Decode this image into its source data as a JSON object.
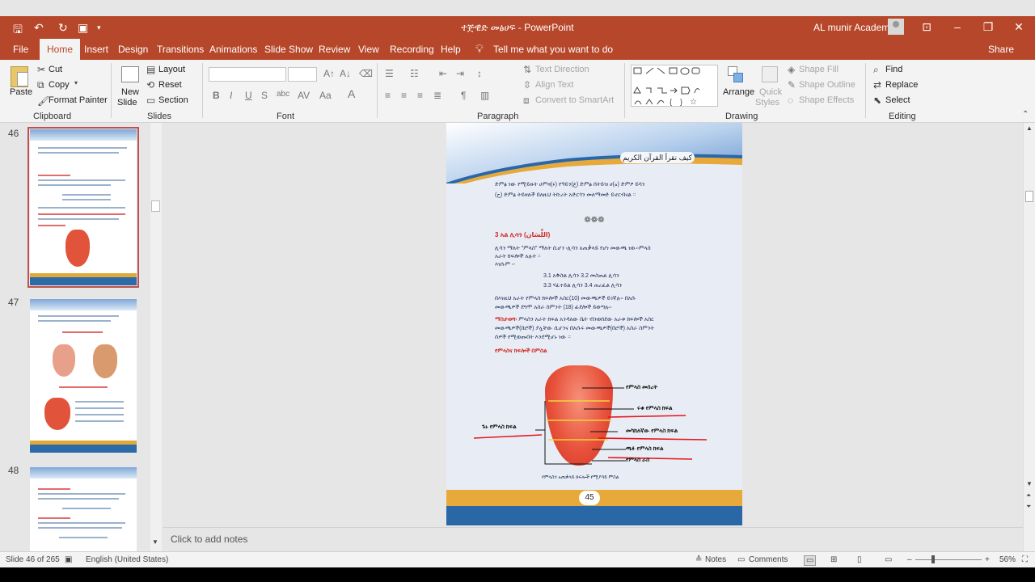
{
  "window": {
    "title": "ተጅዊድ መፅሀፍ  -  PowerPoint",
    "user": "AL munir Academy"
  },
  "tabs": [
    "File",
    "Home",
    "Insert",
    "Design",
    "Transitions",
    "Animations",
    "Slide Show",
    "Review",
    "View",
    "Recording",
    "Help"
  ],
  "tell_me": "Tell me what you want to do",
  "share": "Share",
  "ribbon": {
    "clipboard": {
      "paste": "Paste",
      "cut": "Cut",
      "copy": "Copy",
      "format_painter": "Format Painter",
      "label": "Clipboard"
    },
    "slides": {
      "new_slide_1": "New",
      "new_slide_2": "Slide",
      "layout": "Layout",
      "reset": "Reset",
      "section": "Section",
      "label": "Slides"
    },
    "font": {
      "label": "Font"
    },
    "paragraph": {
      "text_direction": "Text Direction",
      "align_text": "Align Text",
      "convert_smartart": "Convert to SmartArt",
      "label": "Paragraph"
    },
    "drawing": {
      "arrange": "Arrange",
      "quick_styles_1": "Quick",
      "quick_styles_2": "Styles",
      "shape_fill": "Shape Fill",
      "shape_outline": "Shape Outline",
      "shape_effects": "Shape Effects",
      "label": "Drawing"
    },
    "editing": {
      "find": "Find",
      "replace": "Replace",
      "select": "Select",
      "label": "Editing"
    }
  },
  "thumbnails": [
    {
      "number": "46"
    },
    {
      "number": "47"
    },
    {
      "number": "48"
    }
  ],
  "slide": {
    "arabic_title": "كيف نقرأ القرآن الكريم",
    "intro_1": "ድምፅ ነው የሚይዙት ሀምዛ(ء)  የዓይን(ع)  ድምፅ ሰትይዝ ሀ(ه)  ድምፆ  ይሳን",
    "intro_2": "(ح) ድምፅ ትይዛለች በለዚህ ትኩረት አድርጎን መለማመድ ይኖርብናል ።",
    "separator": "❁❁❁",
    "heading": "3 አል ሊሳን (اللِّسَان)",
    "p1_1": "ሊሳን ማለት \"ምላስ\" ማለት ሲሆን ፡ሊሳን አጠቃላይ የሆነ መውጫ ነው፡፡ምላስ",
    "p1_2": "አራት ክፍሎች አሉት ።",
    "p1_3": "እነሱም ፡-",
    "list_1": "3.1 አቅስል ሊሳን       3.2 መስጠል ሊሳን",
    "list_2": "3.3 ሃፈተይል ሊሳን     3.4 ጠረፈል ሊሳን",
    "p2_1": "በእነዚህ  አራት  የምላስ  ክፍሎች  አስር(10)  መውጫዎች  ይገኛሉ፡፡  በአሱ",
    "p2_2": "መውጫዎች  ደግሞ አስራ ስምንት (18) ፊደሎች ይወጣሉ፡፡",
    "note_label": "ማስታወሻ፡",
    "note_1": " ምላስን አራት ክፍል አንዳለው ቤት ብንወሰደው  አራቱ ክፍሎች አስር",
    "note_2": "መውጫዎች(በሮች) ያሏቸው ሲሆንና በአሱሩ መውጫዎች(በሮች) አስራ ስምንት",
    "note_3": "ሰዎች የሚወጡበት  እንደሚሆኑ ነው ።",
    "figure_title": "የምላስና ክፍሎች በምስል",
    "labels": {
      "root": "የምላስ መሰረት",
      "back": "ሩቁ የምላስ ክፍል",
      "middle": "መካከለኛው የምላስ ክፍል",
      "edge": "ጫፉ የምላስ ክፍል",
      "tip": "የምላስ ራስ",
      "side": "ጉኑ የምላስ ክፍል"
    },
    "caption": "የምላስን አጠቃላይ ክፍሎች የሚያሳይ ምስል",
    "page_number": "45"
  },
  "notes_placeholder": "Click to add notes",
  "status": {
    "slide_of": "Slide 46 of 265",
    "language": "English (United States)",
    "notes": "Notes",
    "comments": "Comments",
    "zoom": "56%"
  }
}
